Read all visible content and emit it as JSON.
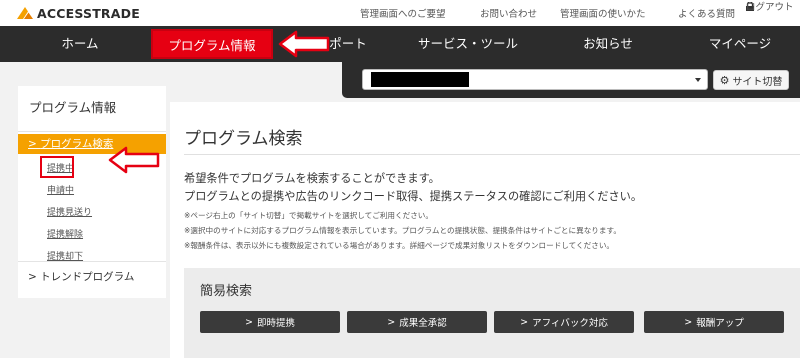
{
  "brand": {
    "name": "ACCESSTRADE"
  },
  "toplinks": [
    "管理画面へのご要望",
    "お問い合わせ",
    "管理画面の使いかた",
    "よくある質問",
    "ログアウト"
  ],
  "nav": [
    "ホーム",
    "プログラム情報",
    "ポート",
    "サービス・ツール",
    "お知らせ",
    "マイページ"
  ],
  "site_switch": {
    "button": "サイト切替"
  },
  "sidebar": {
    "title": "プログラム情報",
    "active": "プログラム検索",
    "sub_items": [
      "提携中",
      "申請中",
      "提携見送り",
      "提携解除",
      "提携却下"
    ],
    "trend": "トレンドプログラム"
  },
  "main": {
    "title": "プログラム検索",
    "desc": [
      "希望条件でプログラムを検索することができます。",
      "プログラムとの提携や広告のリンクコード取得、提携ステータスの確認にご利用ください。"
    ],
    "notes": [
      "※ページ右上の「サイト切替」で掲載サイトを選択してご利用ください。",
      "※選択中のサイトに対応するプログラム情報を表示しています。プログラムとの提携状態、提携条件はサイトごとに異なります。",
      "※報酬条件は、表示以外にも複数設定されている場合があります。詳細ページで成果対象リストをダウンロードしてください。"
    ]
  },
  "quick_search": {
    "title": "簡易検索",
    "buttons": [
      "即時提携",
      "成果全承認",
      "アフィバック対応",
      "報酬アップ"
    ]
  },
  "colors": {
    "nav_bg": "#2c2c2c",
    "accent_orange": "#f5a100",
    "callout_red": "#e60012"
  }
}
